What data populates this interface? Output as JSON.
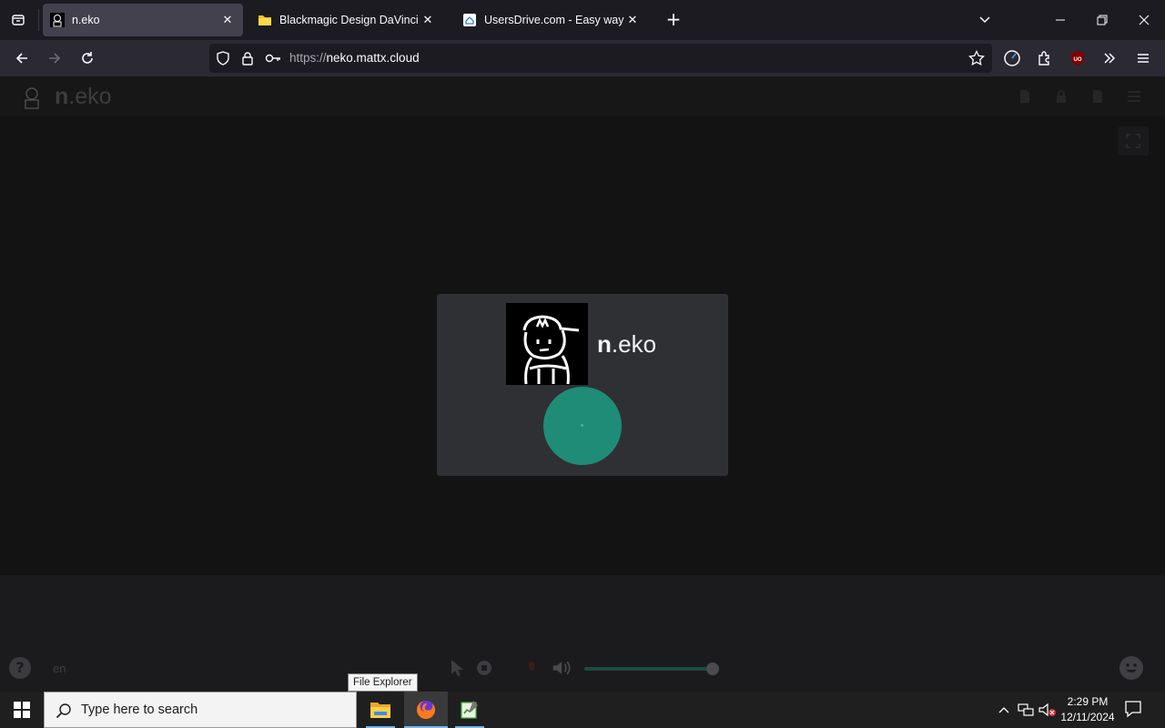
{
  "browser": {
    "tabs": [
      {
        "title": "n.eko",
        "active": true
      },
      {
        "title": "Blackmagic Design DaVinci Res",
        "active": false
      },
      {
        "title": "UsersDrive.com - Easy way to s",
        "active": false
      }
    ],
    "url": {
      "prefix": "https://",
      "domain": "neko.mattx.cloud"
    }
  },
  "neko": {
    "header_title_bold": "n",
    "header_title_rest": ".eko",
    "connect_title_bold": "n",
    "connect_title_rest": ".eko",
    "language": "en",
    "volume_level": 1.0
  },
  "taskbar": {
    "search_placeholder": "Type here to search",
    "tooltip": "File Explorer",
    "time": "2:29 PM",
    "date": "12/11/2024"
  },
  "colors": {
    "accent_teal": "#1f8c77",
    "browser_dark": "#1c1b22",
    "page_dark": "#131314"
  },
  "icons": [
    "list-all-tabs-icon",
    "neko-favicon",
    "folder-favicon",
    "usersdrive-favicon",
    "back-icon",
    "forward-icon",
    "reload-icon",
    "shield-icon",
    "lock-icon",
    "key-icon",
    "bookmark-star-icon",
    "timer-icon",
    "extensions-icon",
    "ublock-icon",
    "overflow-icon",
    "menu-icon",
    "fullscreen-icon",
    "help-icon",
    "cursor-icon",
    "record-icon",
    "volume-icon",
    "emoji-icon",
    "windows-start-icon",
    "search-icon",
    "file-explorer-icon",
    "firefox-icon",
    "notepad-icon",
    "chevron-up-icon",
    "network-icon",
    "speaker-muted-icon",
    "notification-icon"
  ]
}
